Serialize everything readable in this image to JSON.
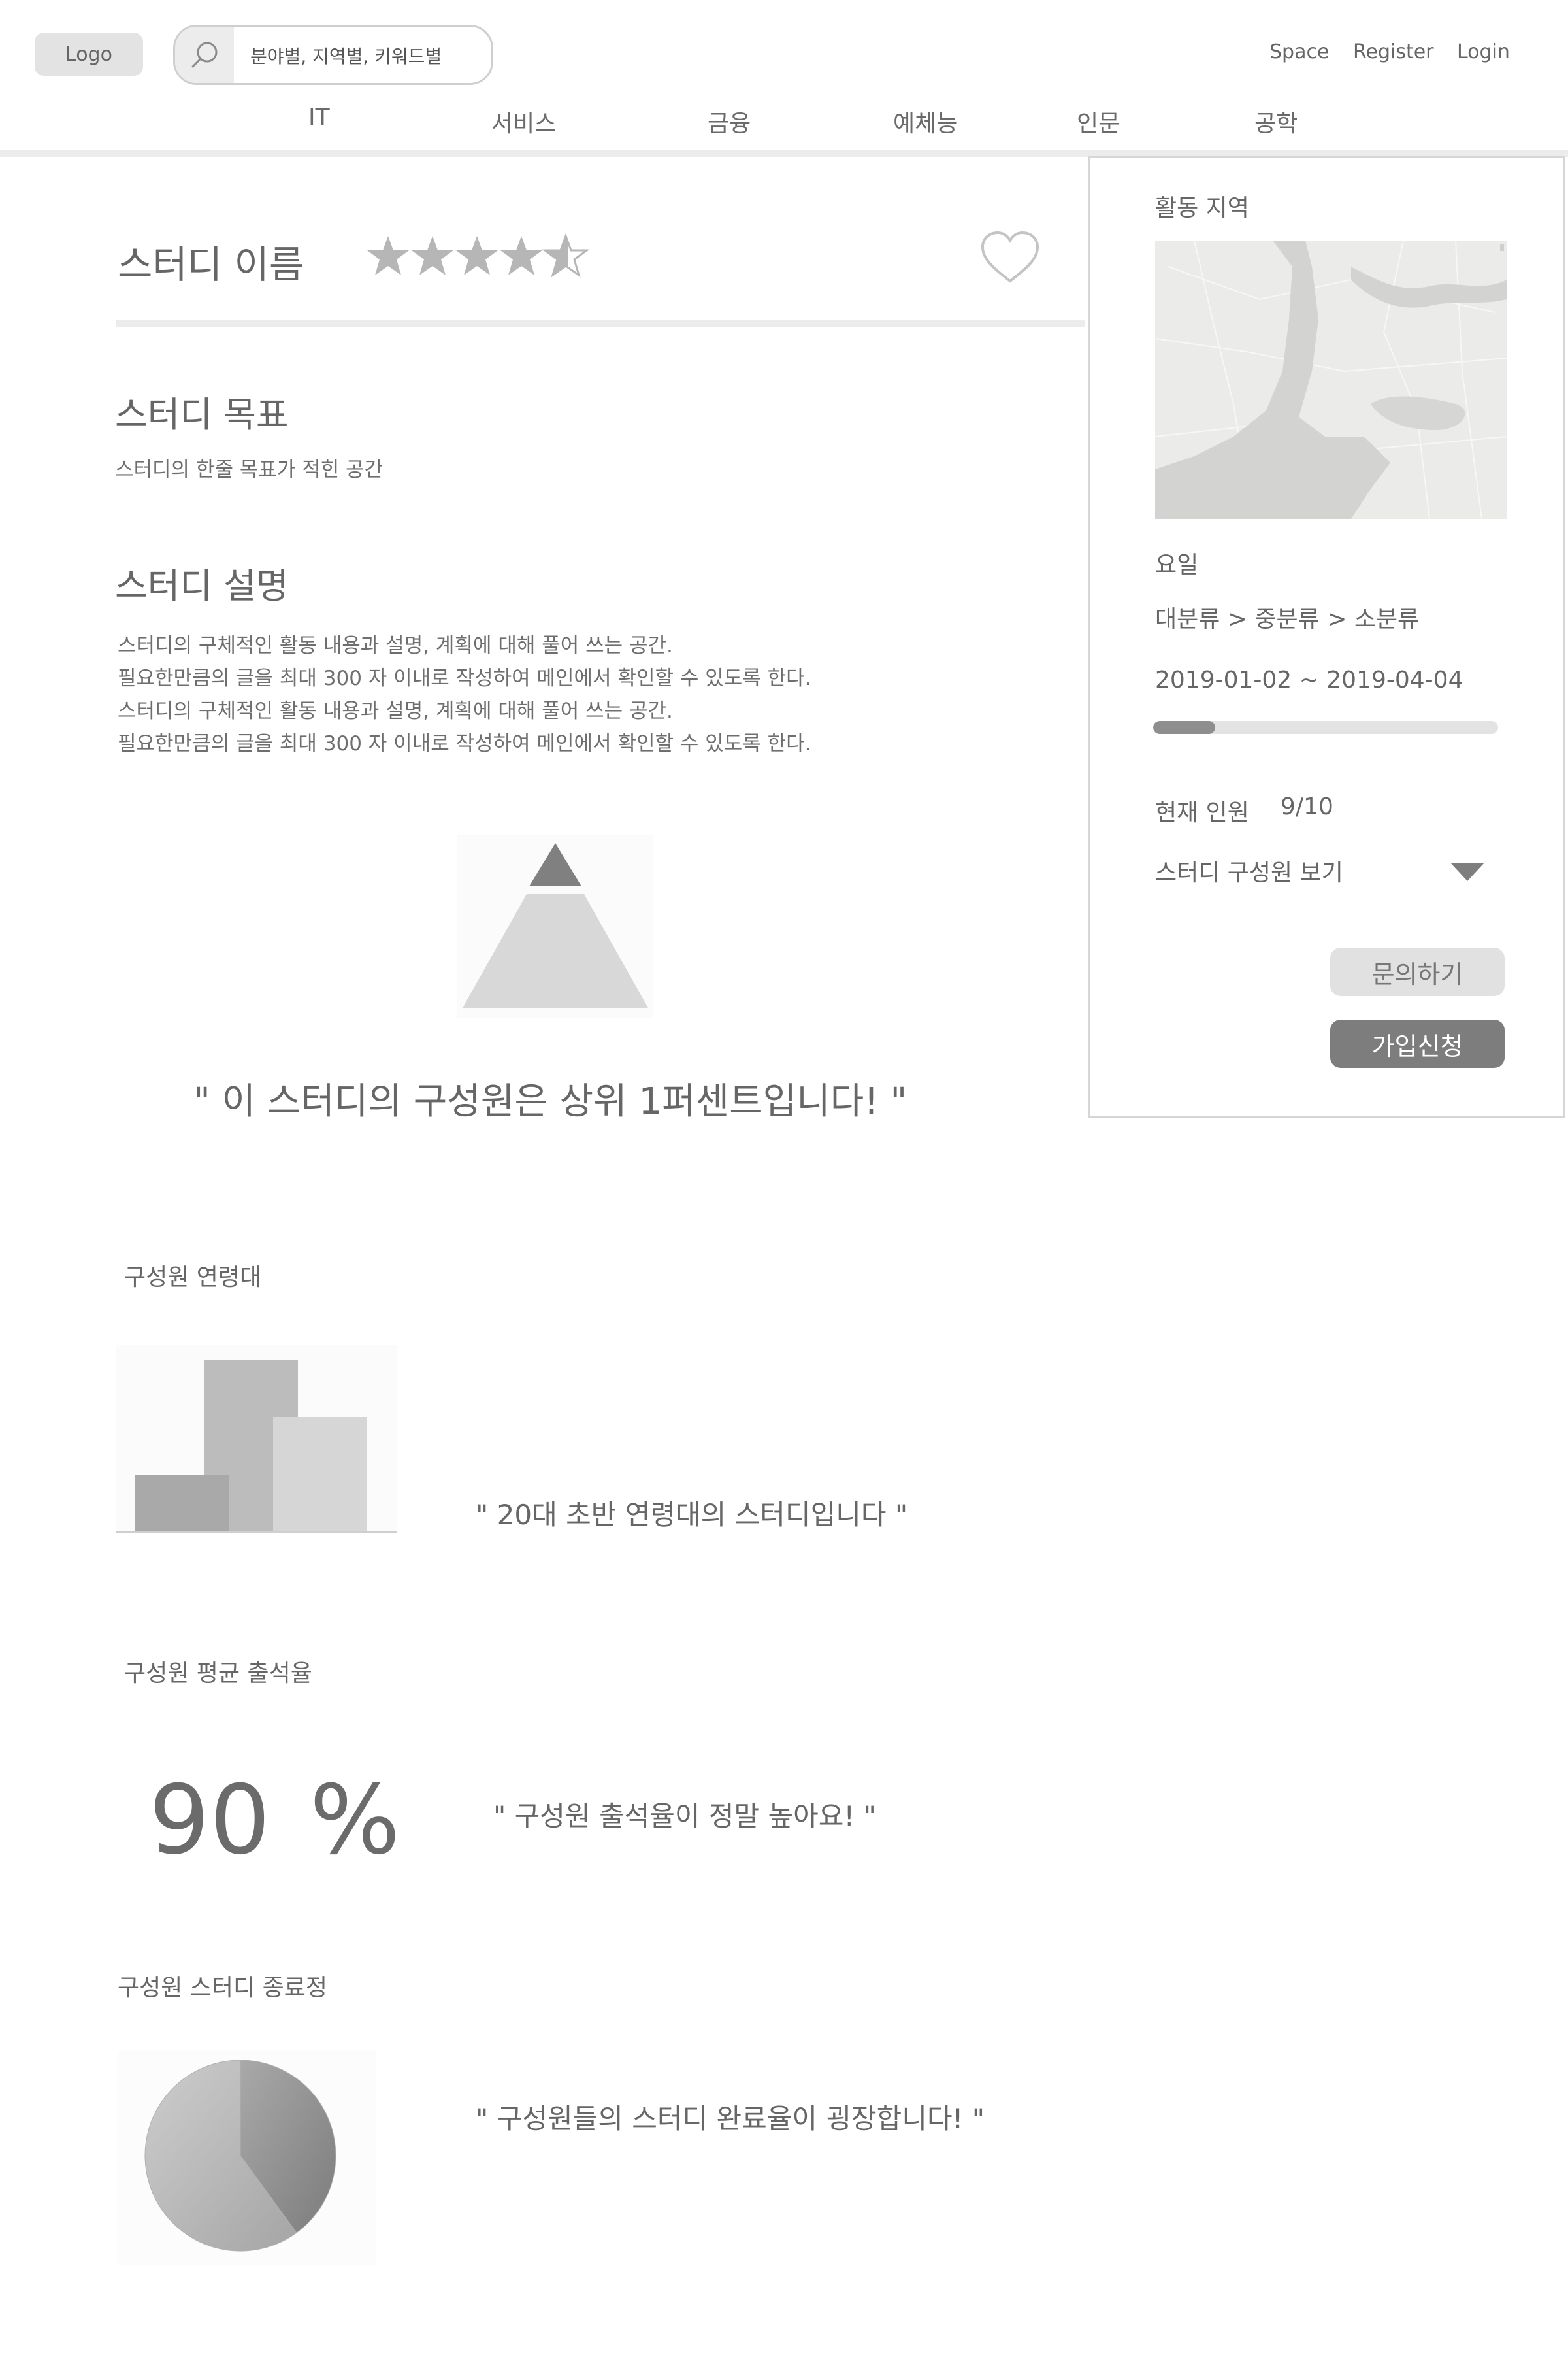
{
  "header": {
    "logo_label": "Logo",
    "search_placeholder": "분야별, 지역별, 키워드별",
    "links": {
      "space": "Space",
      "register": "Register",
      "login": "Login"
    },
    "nav": [
      "IT",
      "서비스",
      "금융",
      "예체능",
      "인문",
      "공학"
    ]
  },
  "study": {
    "name": "스터디 이름",
    "rating": 4.5,
    "rating_max": 5,
    "goal_heading": "스터디 목표",
    "goal_text": "스터디의 한줄 목표가 적힌 공간",
    "desc_heading": "스터디 설명",
    "desc_lines": [
      "스터디의 구체적인 활동 내용과 설명, 계획에 대해 풀어 쓰는 공간.",
      "필요한만큼의 글을 최대 300 자 이내로 작성하여 메인에서 확인할 수 있도록 한다.",
      "스터디의 구체적인 활동 내용과 설명, 계획에 대해 풀어 쓰는 공간.",
      "필요한만큼의 글을 최대 300 자 이내로 작성하여 메인에서 확인할 수 있도록 한다."
    ],
    "rank_quote": "\"   이 스터디의 구성원은 상위 1퍼센트입니다!   \""
  },
  "stats": {
    "age_label": "구성원 연령대",
    "age_quote": "\"  20대 초반 연령대의 스터디입니다  \"",
    "attendance_label": "구성원 평균 출석율",
    "attendance_value": "90",
    "attendance_unit": "%",
    "attendance_quote": "\"  구성원 출석율이 정말 높아요!  \"",
    "completion_label": "구성원 스터디 종료정",
    "completion_quote": "\"  구성원들의 스터디 완료율이 굉장합니다!  \""
  },
  "chart_data": [
    {
      "type": "bar",
      "categories": [
        "",
        "",
        ""
      ],
      "values": [
        3,
        9,
        6
      ],
      "title": "",
      "xlabel": "",
      "ylabel": ""
    },
    {
      "type": "pie",
      "labels": [
        "",
        ""
      ],
      "values": [
        40,
        60
      ],
      "title": ""
    }
  ],
  "sidebar": {
    "location_label": "활동 지역",
    "day_label": "요일",
    "category_path": "대분류 > 중분류 > 소분류",
    "date_range": "2019-01-02 ~ 2019-04-04",
    "period_progress": 0.18,
    "members_label": "현재 인원",
    "members_value": "9/10",
    "members_toggle": "스터디 구성원 보기",
    "inquiry_button": "문의하기",
    "join_button": "가입신청"
  }
}
